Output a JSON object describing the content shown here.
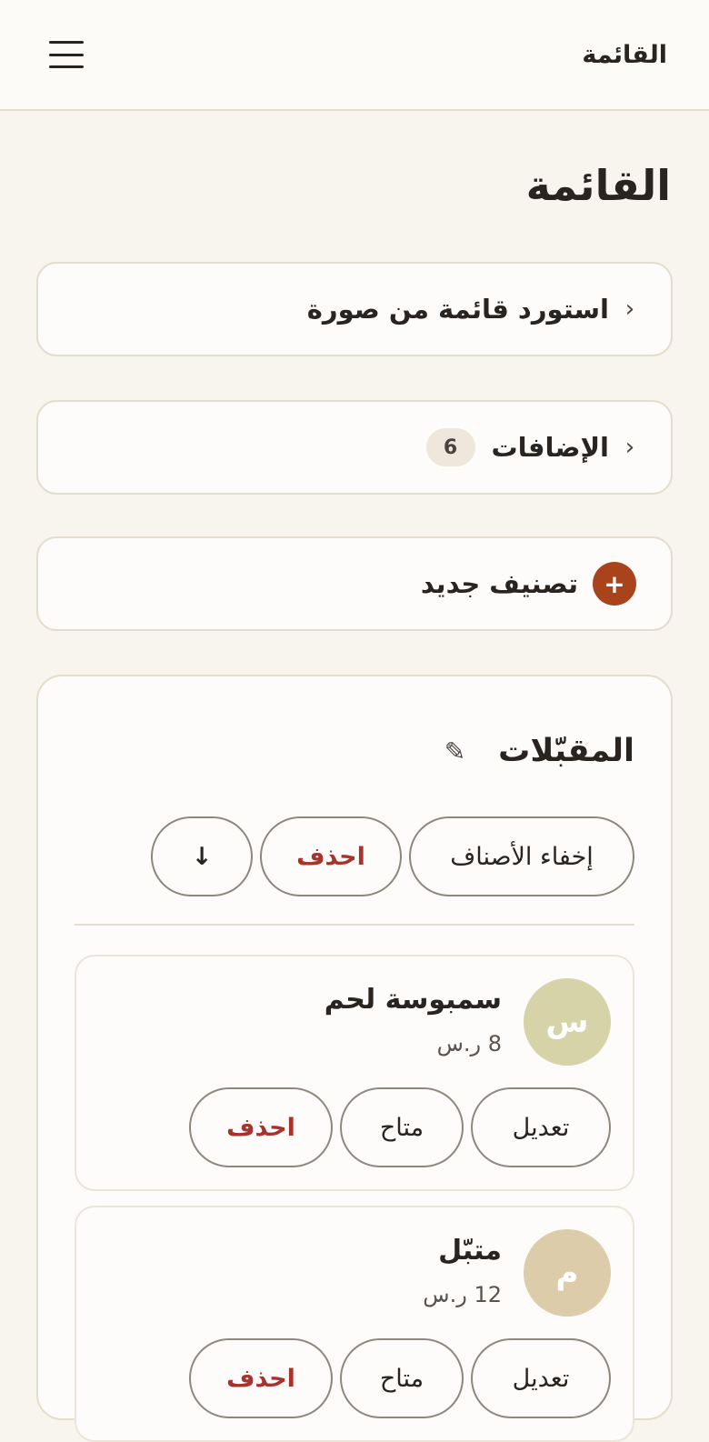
{
  "topbar": {
    "title": "القائمة"
  },
  "page": {
    "title": "القائمة"
  },
  "rows": {
    "import_label": "استورد قائمة من صورة",
    "addons_label": "الإضافات",
    "addons_count": "6",
    "new_category_label": "تصنيف جديد",
    "plus_symbol": "+",
    "chevron": "‹"
  },
  "section": {
    "title": "المقبّلات",
    "hide_items_label": "إخفاء الأصناف",
    "delete_label": "احذف",
    "move_down_symbol": "↓",
    "items": [
      {
        "initial": "س",
        "avatar_color": "#d6d3a8",
        "name": "سمبوسة لحم",
        "price": "8 ر.س",
        "edit_label": "تعديل",
        "available_label": "متاح",
        "delete_label": "احذف"
      },
      {
        "initial": "م",
        "avatar_color": "#dccca9",
        "name": "متبّل",
        "price": "12 ر.س",
        "edit_label": "تعديل",
        "available_label": "متاح",
        "delete_label": "احذف"
      }
    ]
  },
  "colors": {
    "accent": "#a8431c",
    "danger": "#a8332c",
    "background": "#f8f4ee"
  }
}
